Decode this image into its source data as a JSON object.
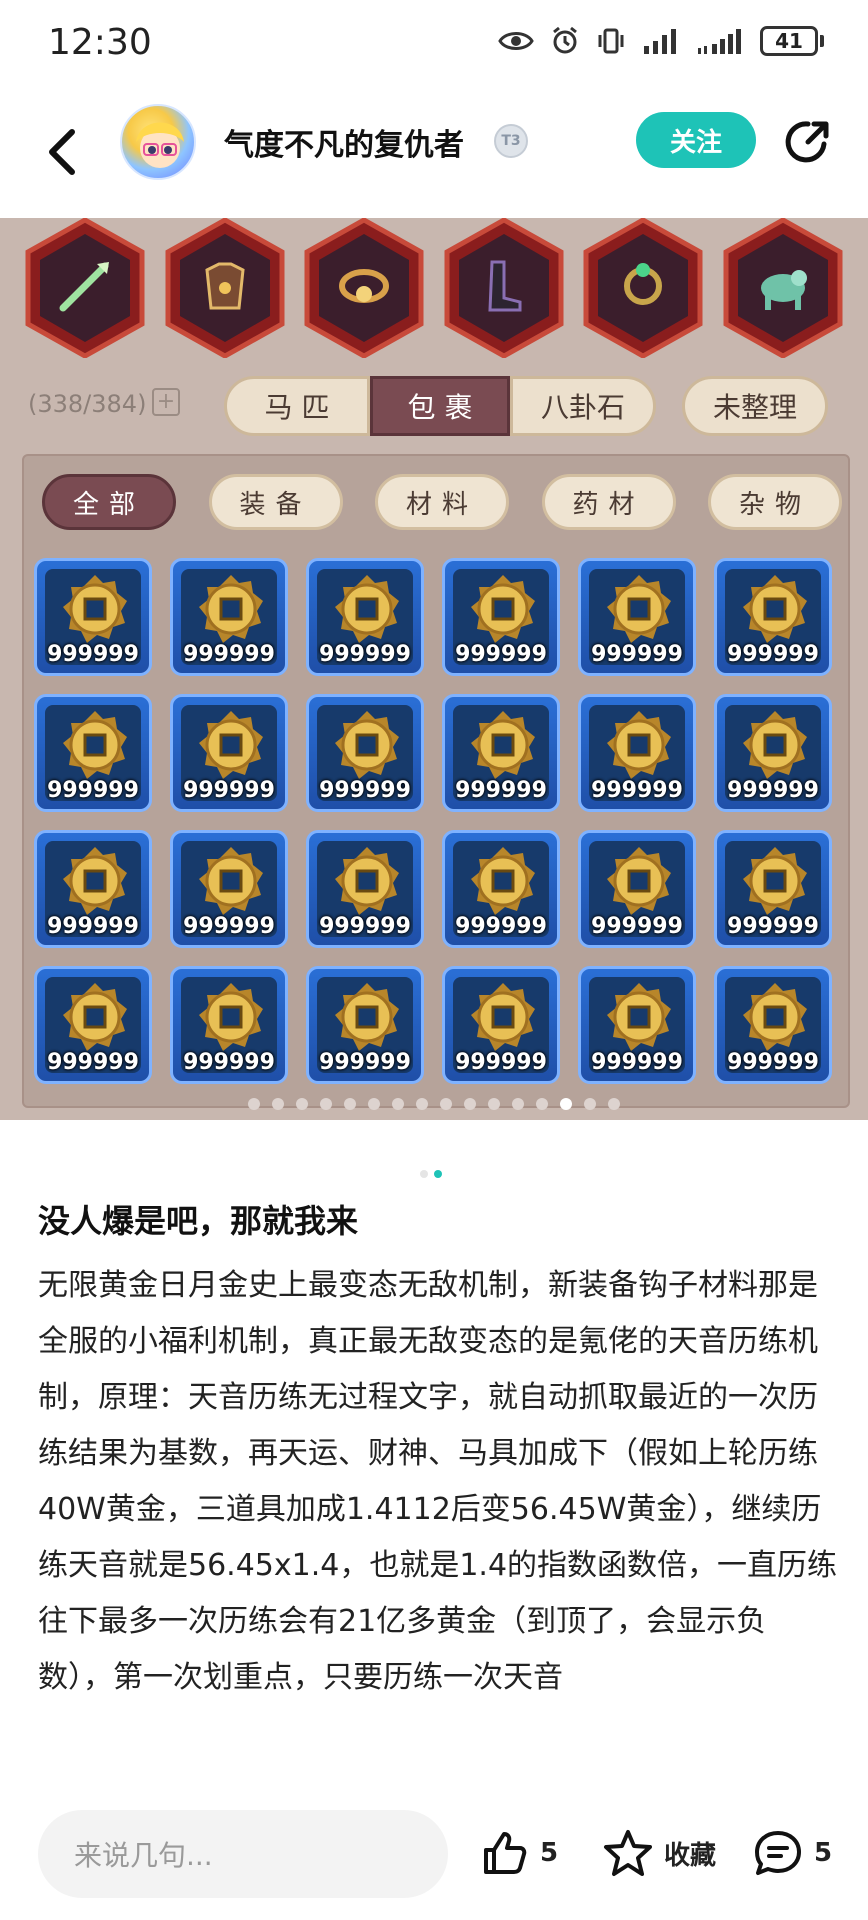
{
  "status_bar": {
    "time": "12:30",
    "battery": "41",
    "icons": [
      "eye-icon",
      "alarm-icon",
      "vibrate-icon",
      "signal-icon",
      "signal-icon",
      "battery-icon"
    ]
  },
  "header": {
    "author": "气度不凡的复仇者",
    "level_badge": "T3",
    "follow_label": "关注"
  },
  "game": {
    "equipment_icons": [
      "weapon-icon",
      "armor-icon",
      "belt-icon",
      "boots-icon",
      "ring-icon",
      "mount-icon"
    ],
    "inventory_count": "(338/384)",
    "plus_label": "+",
    "tabs": [
      {
        "label": "马 匹",
        "active": false
      },
      {
        "label": "包 裹",
        "active": true
      },
      {
        "label": "八卦石",
        "active": false
      }
    ],
    "sort_label": "未整理",
    "categories": [
      {
        "label": "全部",
        "active": true
      },
      {
        "label": "装备",
        "active": false
      },
      {
        "label": "材料",
        "active": false
      },
      {
        "label": "药材",
        "active": false
      },
      {
        "label": "杂物",
        "active": false
      }
    ],
    "slot_quantity": "999999",
    "slot_count": 24,
    "page_count": 16,
    "current_page": 14
  },
  "image_indicator": {
    "count": 2,
    "current": 2
  },
  "post": {
    "title": "没人爆是吧，那就我来",
    "body": "无限黄金日月金史上最变态无敌机制，新装备钩子材料那是全服的小福利机制，真正最无敌变态的是氪佬的天音历练机制，原理：天音历练无过程文字，就自动抓取最近的一次历练结果为基数，再天运、财神、马具加成下（假如上轮历练40W黄金，三道具加成1.4112后变56.45W黄金），继续历练天音就是56.45x1.4，也就是1.4的指数函数倍，一直历练往下最多一次历练会有21亿多黄金（到顶了，会显示负数），第一次划重点，只要历练一次天音"
  },
  "bottom_bar": {
    "input_placeholder": "来说几句...",
    "like_count": "5",
    "collect_label": "收藏",
    "comment_count": "5"
  },
  "colors": {
    "accent": "#1ec3b7",
    "tab_active": "#7a4b52",
    "slot_blue": "#2a6fd6"
  }
}
